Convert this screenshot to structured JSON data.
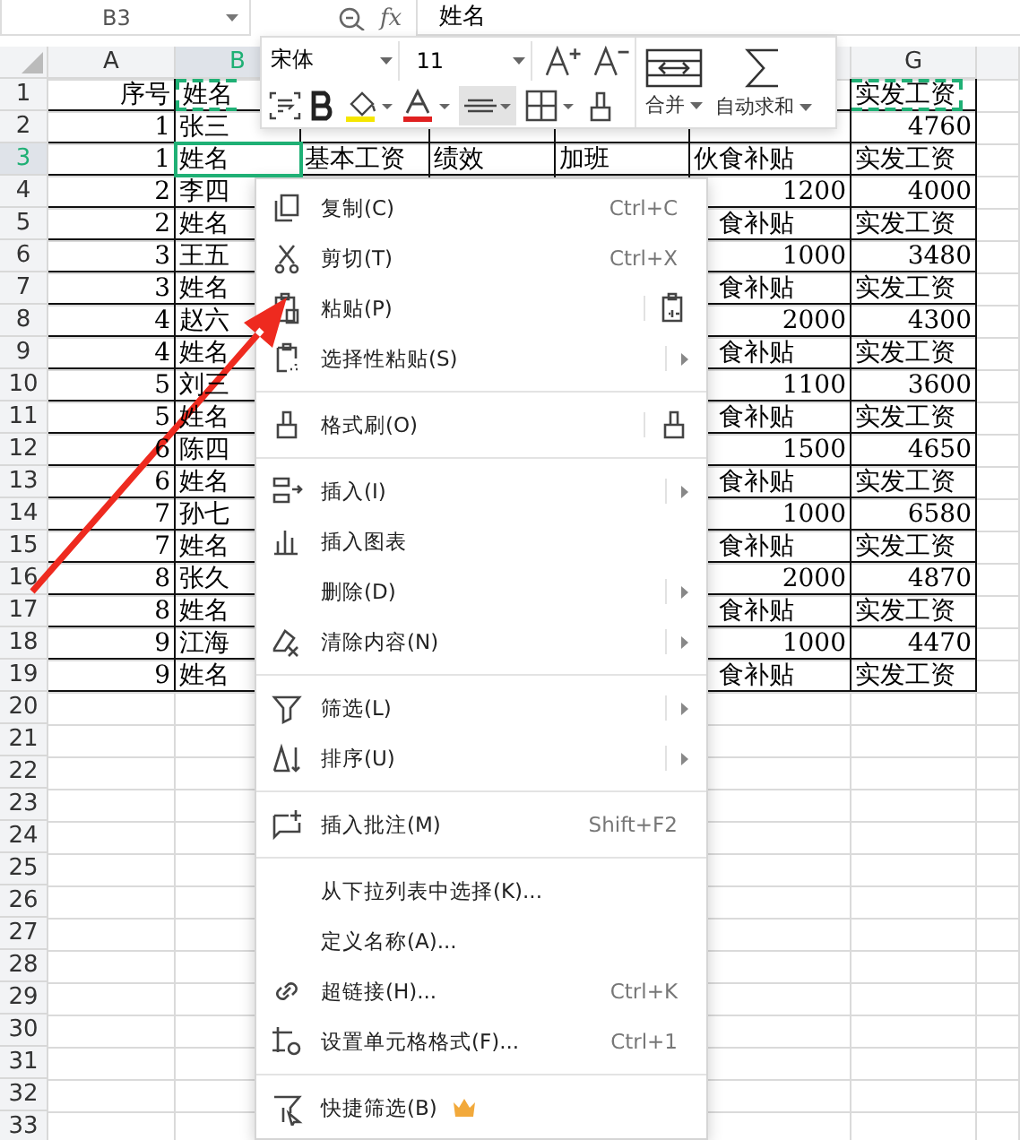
{
  "formula_bar": {
    "name_box": "B3",
    "fx": "fx",
    "value": "姓名"
  },
  "column_headers": [
    {
      "label": "A",
      "selected": false
    },
    {
      "label": "B",
      "selected": true
    },
    {
      "label": "G",
      "selected": false
    }
  ],
  "rows": [
    {
      "number": "1",
      "kind": "header",
      "selected": false,
      "copied": true,
      "cells": {
        "A": "序号",
        "B": "姓名",
        "G": "实发工资"
      }
    },
    {
      "number": "2",
      "kind": "data",
      "selected": false,
      "copied": false,
      "cells": {
        "A": "1",
        "B": "张三",
        "G": "4760"
      }
    },
    {
      "number": "3",
      "kind": "header",
      "selected": true,
      "copied": false,
      "cells": {
        "A": "1",
        "B": "姓名",
        "C": "基本工资",
        "D": "绩效",
        "E": "加班",
        "F": "伙食补贴",
        "G": "实发工资"
      }
    },
    {
      "number": "4",
      "kind": "data",
      "selected": false,
      "copied": false,
      "cells": {
        "A": "2",
        "B": "李四",
        "F": "1200",
        "G": "4000"
      }
    },
    {
      "number": "5",
      "kind": "header",
      "selected": false,
      "copied": false,
      "cells": {
        "A": "2",
        "B": "姓名",
        "F": "食补贴",
        "G": "实发工资"
      }
    },
    {
      "number": "6",
      "kind": "data",
      "selected": false,
      "copied": false,
      "cells": {
        "A": "3",
        "B": "王五",
        "F": "1000",
        "G": "3480"
      }
    },
    {
      "number": "7",
      "kind": "header",
      "selected": false,
      "copied": false,
      "cells": {
        "A": "3",
        "B": "姓名",
        "F": "食补贴",
        "G": "实发工资"
      }
    },
    {
      "number": "8",
      "kind": "data",
      "selected": false,
      "copied": false,
      "cells": {
        "A": "4",
        "B": "赵六",
        "F": "2000",
        "G": "4300"
      }
    },
    {
      "number": "9",
      "kind": "header",
      "selected": false,
      "copied": false,
      "cells": {
        "A": "4",
        "B": "姓名",
        "F": "食补贴",
        "G": "实发工资"
      }
    },
    {
      "number": "10",
      "kind": "data",
      "selected": false,
      "copied": false,
      "cells": {
        "A": "5",
        "B": "刘三",
        "F": "1100",
        "G": "3600"
      }
    },
    {
      "number": "11",
      "kind": "header",
      "selected": false,
      "copied": false,
      "cells": {
        "A": "5",
        "B": "姓名",
        "F": "食补贴",
        "G": "实发工资"
      }
    },
    {
      "number": "12",
      "kind": "data",
      "selected": false,
      "copied": false,
      "cells": {
        "A": "6",
        "B": "陈四",
        "F": "1500",
        "G": "4650"
      }
    },
    {
      "number": "13",
      "kind": "header",
      "selected": false,
      "copied": false,
      "cells": {
        "A": "6",
        "B": "姓名",
        "F": "食补贴",
        "G": "实发工资"
      }
    },
    {
      "number": "14",
      "kind": "data",
      "selected": false,
      "copied": false,
      "cells": {
        "A": "7",
        "B": "孙七",
        "F": "1000",
        "G": "6580"
      }
    },
    {
      "number": "15",
      "kind": "header",
      "selected": false,
      "copied": false,
      "cells": {
        "A": "7",
        "B": "姓名",
        "F": "食补贴",
        "G": "实发工资"
      }
    },
    {
      "number": "16",
      "kind": "data",
      "selected": false,
      "copied": false,
      "cells": {
        "A": "8",
        "B": "张久",
        "F": "2000",
        "G": "4870"
      }
    },
    {
      "number": "17",
      "kind": "header",
      "selected": false,
      "copied": false,
      "cells": {
        "A": "8",
        "B": "姓名",
        "F": "食补贴",
        "G": "实发工资"
      }
    },
    {
      "number": "18",
      "kind": "data",
      "selected": false,
      "copied": false,
      "cells": {
        "A": "9",
        "B": "江海",
        "F": "1000",
        "G": "4470"
      }
    },
    {
      "number": "19",
      "kind": "header",
      "selected": false,
      "copied": false,
      "cells": {
        "A": "9",
        "B": "姓名",
        "F": "食补贴",
        "G": "实发工资"
      }
    }
  ],
  "empty_rows": [
    "20",
    "21",
    "22",
    "23",
    "24",
    "25",
    "26",
    "27",
    "28",
    "29",
    "30",
    "31",
    "32",
    "33"
  ],
  "toolbar": {
    "font": "宋体",
    "size": "11",
    "align_pressed": true,
    "merge": "合并",
    "autosum": "自动求和"
  },
  "context_menu": {
    "groups": [
      {
        "items": [
          {
            "label": "复制(C)",
            "shortcut": "Ctrl+C",
            "submenu": false,
            "split": false,
            "premium": false
          },
          {
            "label": "剪切(T)",
            "shortcut": "Ctrl+X",
            "submenu": false,
            "split": false,
            "premium": false
          },
          {
            "label": "粘贴(P)",
            "submenu": false,
            "split": true,
            "premium": false
          },
          {
            "label": "选择性粘贴(S)",
            "submenu": true,
            "split": false,
            "premium": false
          }
        ]
      },
      {
        "items": [
          {
            "label": "格式刷(O)",
            "submenu": false,
            "split": true,
            "premium": false
          }
        ]
      },
      {
        "items": [
          {
            "label": "插入(I)",
            "submenu": true,
            "split": false,
            "premium": false
          },
          {
            "label": "插入图表",
            "submenu": false,
            "split": false,
            "premium": false
          },
          {
            "label": "删除(D)",
            "submenu": true,
            "split": false,
            "premium": false
          },
          {
            "label": "清除内容(N)",
            "submenu": true,
            "split": false,
            "premium": false
          }
        ]
      },
      {
        "items": [
          {
            "label": "筛选(L)",
            "submenu": true,
            "split": false,
            "premium": false
          },
          {
            "label": "排序(U)",
            "submenu": true,
            "split": false,
            "premium": false
          }
        ]
      },
      {
        "items": [
          {
            "label": "插入批注(M)",
            "shortcut": "Shift+F2",
            "submenu": false,
            "split": false,
            "premium": false
          }
        ]
      },
      {
        "items": [
          {
            "label": "从下拉列表中选择(K)...",
            "submenu": false,
            "split": false,
            "premium": false
          },
          {
            "label": "定义名称(A)...",
            "submenu": false,
            "split": false,
            "premium": false
          },
          {
            "label": "超链接(H)...",
            "shortcut": "Ctrl+K",
            "submenu": false,
            "split": false,
            "premium": false
          },
          {
            "label": "设置单元格格式(F)...",
            "shortcut": "Ctrl+1",
            "submenu": false,
            "split": false,
            "premium": false
          }
        ]
      },
      {
        "items": [
          {
            "label": "快捷筛选(B)",
            "submenu": false,
            "split": false,
            "premium": true
          }
        ]
      }
    ]
  }
}
